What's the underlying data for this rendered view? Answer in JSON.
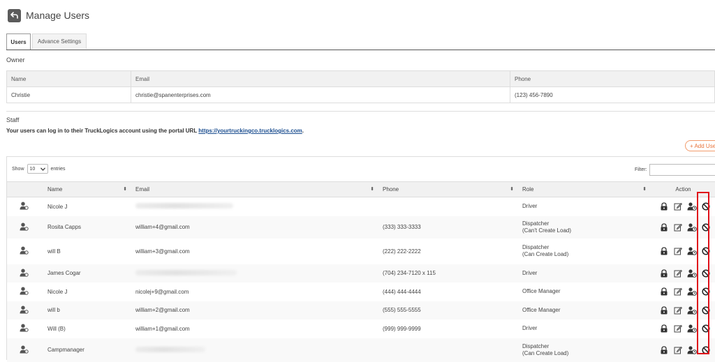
{
  "header": {
    "title": "Manage Users",
    "back_icon": "back-arrow-icon"
  },
  "tabs": [
    {
      "label": "Users",
      "active": true
    },
    {
      "label": "Advance Settings",
      "active": false
    }
  ],
  "owner": {
    "section_label": "Owner",
    "columns": [
      "Name",
      "Email",
      "Phone"
    ],
    "row": {
      "name": "Christie",
      "email": "christie@spanenterprises.com",
      "phone": "(123) 456-7890"
    }
  },
  "staff": {
    "section_label": "Staff",
    "portal_text": "Your users can log in to their TruckLogics account using the portal URL ",
    "portal_url": "https://yourtruckingco.trucklogics.com",
    "portal_suffix": ".",
    "add_user_label": "+ Add Use"
  },
  "table_controls": {
    "show_label": "Show",
    "entries_value": "10",
    "entries_label": "entries",
    "filter_label": "Filter:"
  },
  "users_table": {
    "columns": {
      "name": "Name",
      "email": "Email",
      "phone": "Phone",
      "role": "Role",
      "action": "Action"
    },
    "rows": [
      {
        "name": "Nicole J",
        "email": "",
        "phone": "",
        "role_line1": "Driver",
        "role_line2": "",
        "blurred_email": true
      },
      {
        "name": "Rosita Capps",
        "email": "william+4@gmail.com",
        "phone": "(333) 333-3333",
        "role_line1": "Dispatcher",
        "role_line2": "(Can't Create Load)",
        "blurred_email": false
      },
      {
        "name": "will B",
        "email": "william+3@gmail.com",
        "phone": "(222) 222-2222",
        "role_line1": "Dispatcher",
        "role_line2": "(Can Create Load)",
        "blurred_email": false
      },
      {
        "name": "James Cogar",
        "email": "",
        "phone": "(704) 234-7120 x 115",
        "role_line1": "Driver",
        "role_line2": "",
        "blurred_email": true
      },
      {
        "name": "Nicole J",
        "email": "nicolej+9@gmail.com",
        "phone": "(444) 444-4444",
        "role_line1": "Office Manager",
        "role_line2": "",
        "blurred_email": false
      },
      {
        "name": "will b",
        "email": "william+2@gmail.com",
        "phone": "(555) 555-5555",
        "role_line1": "Office Manager",
        "role_line2": "",
        "blurred_email": false
      },
      {
        "name": "Will (B)",
        "email": "william+1@gmail.com",
        "phone": "(999) 999-9999",
        "role_line1": "Driver",
        "role_line2": "",
        "blurred_email": false
      },
      {
        "name": "Campmanager",
        "email": "",
        "phone": "",
        "role_line1": "Dispatcher",
        "role_line2": "(Can Create Load)",
        "blurred_email": true
      }
    ]
  },
  "colors": {
    "accent_orange": "#e8733a",
    "highlight_red": "#e0101a",
    "link_blue": "#1a4d8f"
  }
}
